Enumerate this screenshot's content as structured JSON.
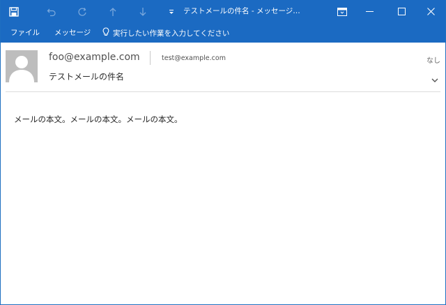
{
  "window": {
    "title": "テストメールの件名  -  メッセージ…"
  },
  "quick_access": {
    "items": [
      {
        "icon": "save-icon",
        "enabled": true
      },
      {
        "icon": "undo-icon",
        "enabled": false
      },
      {
        "icon": "redo-icon",
        "enabled": false
      },
      {
        "icon": "previous-item-icon",
        "enabled": false
      },
      {
        "icon": "next-item-icon",
        "enabled": false
      },
      {
        "icon": "customize-toolbar-icon",
        "enabled": true
      }
    ]
  },
  "window_controls": {
    "icons": [
      "ribbon-display-options-icon",
      "minimize-icon",
      "maximize-icon",
      "close-icon"
    ]
  },
  "ribbon": {
    "tabs": [
      "ファイル",
      "メッセージ"
    ],
    "tell_me": "実行したい作業を入力してください"
  },
  "message": {
    "from": "foo@example.com",
    "to": "test@example.com",
    "subject": "テストメールの件名",
    "attachments_label": "なし",
    "body": "メールの本文。メールの本文。メールの本文。"
  },
  "colors": {
    "accent": "#1b6ac2",
    "avatar_bg": "#bdbdbd"
  }
}
